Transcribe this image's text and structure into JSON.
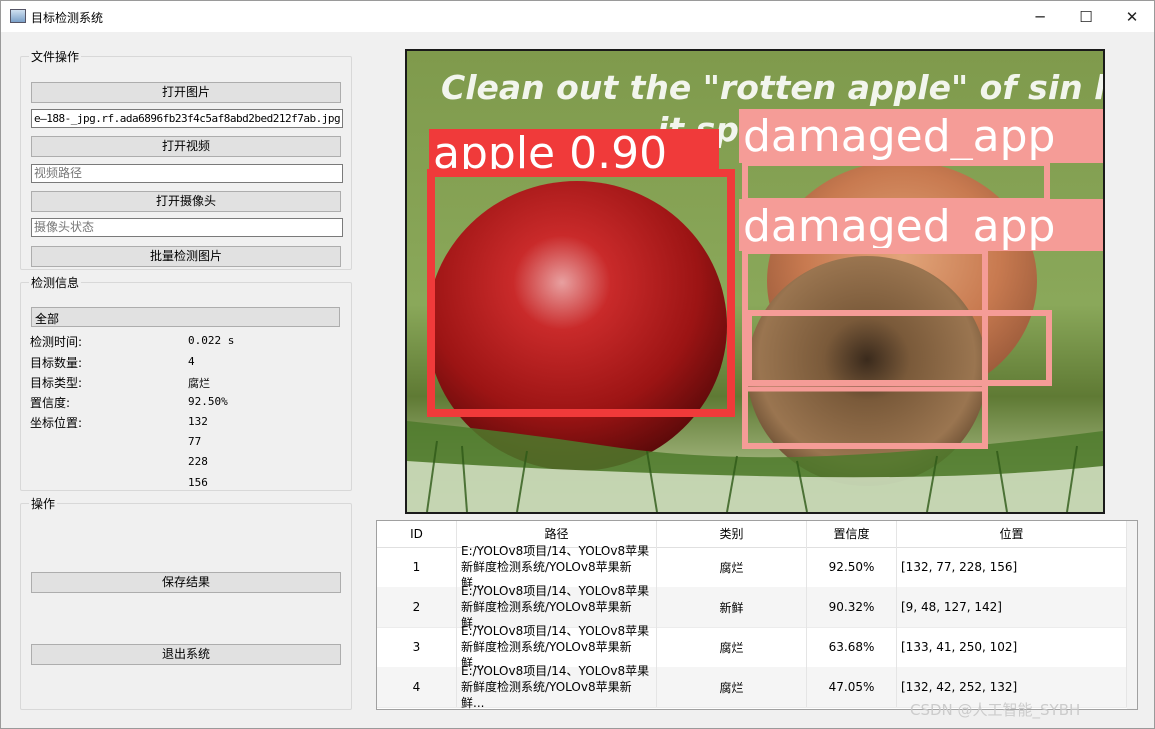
{
  "window": {
    "title": "目标检测系统",
    "controls": {
      "minimize": "─",
      "maximize": "☐",
      "close": "✕"
    }
  },
  "file_ops": {
    "legend": "文件操作",
    "open_image": "打开图片",
    "image_path": "e—188-_jpg.rf.ada6896fb23f4c5af8abd2bed212f7ab.jpg",
    "open_video": "打开视频",
    "video_path_placeholder": "视频路径",
    "open_camera": "打开摄像头",
    "camera_status_placeholder": "摄像头状态",
    "batch_detect": "批量检测图片"
  },
  "detect_info": {
    "legend": "检测信息",
    "filter": {
      "selected": "全部"
    },
    "time_label": "检测时间:",
    "time_value": "0.022 s",
    "count_label": "目标数量:",
    "count_value": "4",
    "type_label": "目标类型:",
    "type_value": "腐烂",
    "conf_label": "置信度:",
    "conf_value": "92.50%",
    "pos_label": "坐标位置:",
    "pos_values": [
      "132",
      "77",
      "228",
      "156"
    ]
  },
  "operations": {
    "legend": "操作",
    "save": "保存结果",
    "exit": "退出系统"
  },
  "image": {
    "caption": "Clean out the \"rotten apple\" of sin lest",
    "caption2": "it spoil the w",
    "detections": [
      {
        "label": "apple 0.90",
        "color": "#f03a3a"
      },
      {
        "label": "damaged_app",
        "color": "#f59c97"
      },
      {
        "label": "damaged_app",
        "color": "#f59c97"
      }
    ]
  },
  "table": {
    "headers": [
      "ID",
      "路径",
      "类别",
      "置信度",
      "位置"
    ],
    "rows": [
      {
        "id": "1",
        "path1": "E:/YOLOv8项目/14、YOLOv8苹果",
        "path2": "新鲜度检测系统/YOLOv8苹果新鲜...",
        "cls": "腐烂",
        "conf": "92.50%",
        "pos": "[132, 77, 228, 156]"
      },
      {
        "id": "2",
        "path1": "E:/YOLOv8项目/14、YOLOv8苹果",
        "path2": "新鲜度检测系统/YOLOv8苹果新鲜...",
        "cls": "新鲜",
        "conf": "90.32%",
        "pos": "[9, 48, 127, 142]"
      },
      {
        "id": "3",
        "path1": "E:/YOLOv8项目/14、YOLOv8苹果",
        "path2": "新鲜度检测系统/YOLOv8苹果新鲜...",
        "cls": "腐烂",
        "conf": "63.68%",
        "pos": "[133, 41, 250, 102]"
      },
      {
        "id": "4",
        "path1": "E:/YOLOv8项目/14、YOLOv8苹果",
        "path2": "新鲜度检测系统/YOLOv8苹果新鲜...",
        "cls": "腐烂",
        "conf": "47.05%",
        "pos": "[132, 42, 252, 132]"
      }
    ]
  },
  "watermark": "CSDN @人工智能_SYBH"
}
